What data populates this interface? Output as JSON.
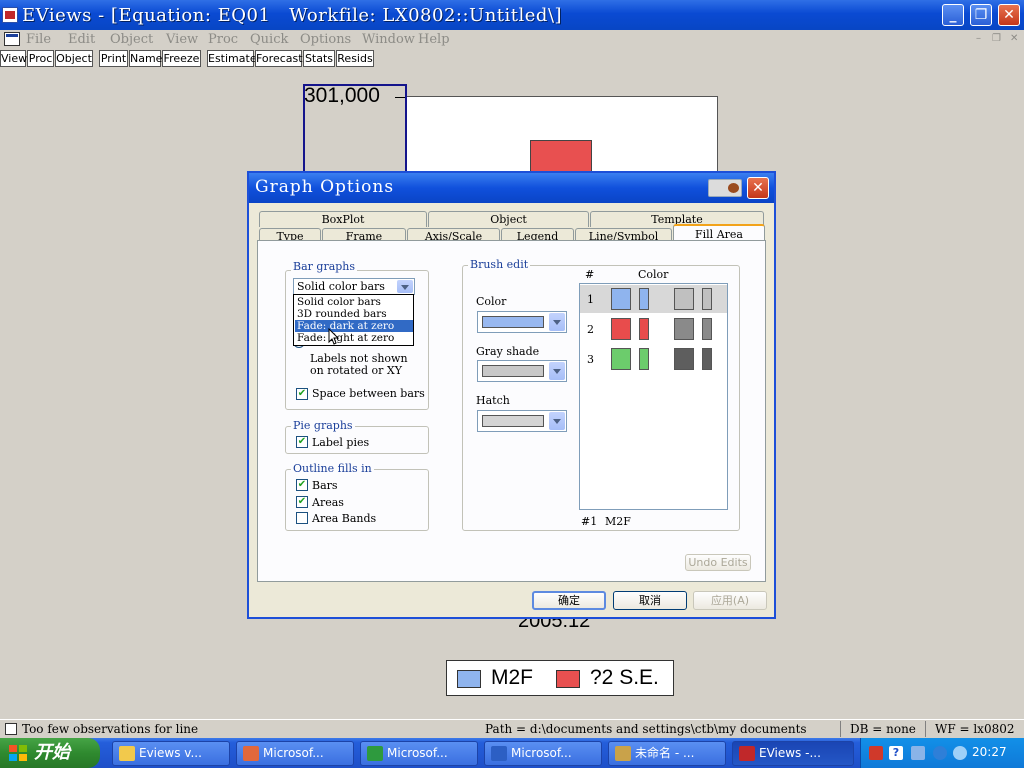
{
  "window": {
    "title": "EViews - [Equation: EQ01   Workfile: LX0802::Untitled\\]",
    "controls": [
      "_",
      "❐",
      "✕"
    ]
  },
  "menubar": {
    "items": [
      "File",
      "Edit",
      "Object",
      "View",
      "Proc",
      "Quick",
      "Options",
      "Window",
      "Help"
    ],
    "mdi_controls": [
      "–",
      "❐",
      "✕"
    ]
  },
  "toolbar": {
    "buttons": [
      "View",
      "Proc",
      "Object",
      "Print",
      "Name",
      "Freeze",
      "Estimate",
      "Forecast",
      "Stats",
      "Resids"
    ]
  },
  "graph": {
    "y_tick_label": "301,000",
    "x_tick_label": "2005:12",
    "legend": [
      {
        "label": "M2F",
        "color": "#8fb4ee"
      },
      {
        "label": "?2 S.E.",
        "color": "#e85050"
      }
    ],
    "bar_color": "#e85050"
  },
  "dialog": {
    "title": "Graph Options",
    "tabs_row1": [
      "BoxPlot",
      "Object",
      "Template"
    ],
    "tabs_row2": [
      "Type",
      "Frame",
      "Axis/Scale",
      "Legend",
      "Line/Symbol",
      "Fill Area"
    ],
    "active_tab": "Fill Area",
    "bar_graphs": {
      "label": "Bar graphs",
      "selected": "Solid color bars",
      "options": [
        "Solid color bars",
        "3D rounded bars",
        "Fade: dark at zero",
        "Fade: light at zero"
      ],
      "highlighted": "Fade: dark at zero",
      "no_bar_labels": "No bar labels",
      "labels_note_line1": "Labels not shown",
      "labels_note_line2": "on rotated or XY",
      "space_between_bars": {
        "label": "Space between bars",
        "checked": true
      }
    },
    "pie_graphs": {
      "label": "Pie graphs",
      "label_pies": {
        "label": "Label pies",
        "checked": true
      }
    },
    "outline_fills": {
      "label": "Outline fills in",
      "items": [
        {
          "label": "Bars",
          "checked": true
        },
        {
          "label": "Areas",
          "checked": true
        },
        {
          "label": "Area Bands",
          "checked": false
        }
      ]
    },
    "brush_edit": {
      "label": "Brush edit",
      "color_label": "Color",
      "color_value": "#98b8f0",
      "gray_label": "Gray shade",
      "gray_value": "#c8c8c8",
      "hatch_label": "Hatch",
      "hatch_value": "#d4d4d4",
      "col_num": "#",
      "col_color": "Color",
      "rows": [
        {
          "num": "1",
          "color": "#8fb4ee",
          "gray": "#c0c0c0"
        },
        {
          "num": "2",
          "color": "#e84c4c",
          "gray": "#8a8a8a"
        },
        {
          "num": "3",
          "color": "#6ccc6c",
          "gray": "#5e5e5e"
        }
      ],
      "footer_num": "#1",
      "footer_name": "M2F",
      "undo_label": "Undo Edits"
    },
    "buttons": {
      "ok": "确定",
      "cancel": "取消",
      "apply": "应用(A)"
    }
  },
  "statusbar": {
    "message": "Too few observations for line",
    "path": "Path = d:\\documents and settings\\ctb\\my documents",
    "db": "DB = none",
    "wf": "WF = lx0802"
  },
  "taskbar": {
    "start_label": "开始",
    "items": [
      {
        "label": "Eviews v...",
        "icon_color": "#f2c94c"
      },
      {
        "label": "Microsof...",
        "icon_color": "#e2683c"
      },
      {
        "label": "Microsof...",
        "icon_color": "#2e9a3e"
      },
      {
        "label": "Microsof...",
        "icon_color": "#2c5fc4"
      },
      {
        "label": "未命名 - ...",
        "icon_color": "#c9a24a"
      },
      {
        "label": "EViews -...",
        "icon_color": "#c0282a"
      }
    ],
    "clock": "20:27"
  }
}
